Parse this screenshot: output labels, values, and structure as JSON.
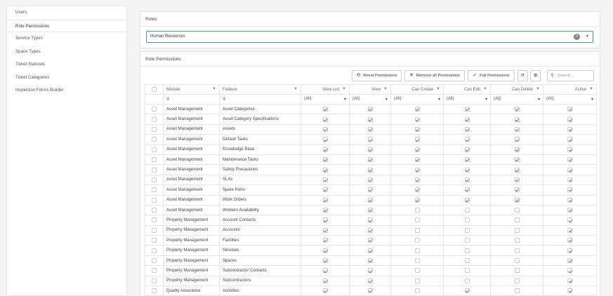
{
  "sidebar": {
    "items": [
      {
        "label": "Users",
        "active": false
      },
      {
        "label": "Role Permissions",
        "active": true
      },
      {
        "label": "Service Types",
        "active": false
      },
      {
        "label": "Space Types",
        "active": false
      },
      {
        "label": "Ticket Statuses",
        "active": false
      },
      {
        "label": "Ticket Categories",
        "active": false
      },
      {
        "label": "Inspection Forms Builder",
        "active": false
      }
    ]
  },
  "roles": {
    "title": "Roles",
    "selected": "Human Resources"
  },
  "permissions": {
    "title": "Role Permissions",
    "toolbar": {
      "reset_label": "Reset Permissions",
      "remove_label": "Remove all Permissions",
      "full_label": "Full Permissions",
      "search_placeholder": "Search..."
    },
    "columns": [
      "Module",
      "Feature",
      "View List",
      "View",
      "Can Create",
      "Can Edit",
      "Can Delete",
      "Active"
    ],
    "filter_all": "(All)",
    "rows": [
      {
        "module": "Asset Management",
        "feature": "Asset Categories",
        "view_list": true,
        "view": true,
        "can_create": true,
        "can_edit": true,
        "can_delete": true,
        "active": true
      },
      {
        "module": "Asset Management",
        "feature": "Asset Category Specifications",
        "view_list": true,
        "view": true,
        "can_create": true,
        "can_edit": true,
        "can_delete": true,
        "active": true
      },
      {
        "module": "Asset Management",
        "feature": "Assets",
        "view_list": true,
        "view": true,
        "can_create": true,
        "can_edit": true,
        "can_delete": true,
        "active": true
      },
      {
        "module": "Asset Management",
        "feature": "Default Tasks",
        "view_list": true,
        "view": true,
        "can_create": true,
        "can_edit": true,
        "can_delete": true,
        "active": true
      },
      {
        "module": "Asset Management",
        "feature": "Knowledge Base",
        "view_list": true,
        "view": true,
        "can_create": true,
        "can_edit": true,
        "can_delete": true,
        "active": true
      },
      {
        "module": "Asset Management",
        "feature": "Maintenance Tasks",
        "view_list": true,
        "view": true,
        "can_create": true,
        "can_edit": true,
        "can_delete": true,
        "active": true
      },
      {
        "module": "Asset Management",
        "feature": "Safety Precautions",
        "view_list": true,
        "view": true,
        "can_create": true,
        "can_edit": true,
        "can_delete": true,
        "active": true
      },
      {
        "module": "Asset Management",
        "feature": "SLAs",
        "view_list": true,
        "view": true,
        "can_create": true,
        "can_edit": true,
        "can_delete": true,
        "active": true
      },
      {
        "module": "Asset Management",
        "feature": "Spare Parts",
        "view_list": true,
        "view": true,
        "can_create": true,
        "can_edit": true,
        "can_delete": true,
        "active": true
      },
      {
        "module": "Asset Management",
        "feature": "Work Orders",
        "view_list": true,
        "view": true,
        "can_create": true,
        "can_edit": true,
        "can_delete": true,
        "active": true
      },
      {
        "module": "Asset Management",
        "feature": "Workers Availability",
        "view_list": true,
        "view": true,
        "can_create": false,
        "can_edit": false,
        "can_delete": false,
        "active": true
      },
      {
        "module": "Property Management",
        "feature": "Account Contacts",
        "view_list": true,
        "view": true,
        "can_create": false,
        "can_edit": false,
        "can_delete": false,
        "active": true
      },
      {
        "module": "Property Management",
        "feature": "Accounts",
        "view_list": true,
        "view": true,
        "can_create": false,
        "can_edit": false,
        "can_delete": false,
        "active": true
      },
      {
        "module": "Property Management",
        "feature": "Facilities",
        "view_list": true,
        "view": true,
        "can_create": false,
        "can_edit": false,
        "can_delete": false,
        "active": true
      },
      {
        "module": "Property Management",
        "feature": "Services",
        "view_list": true,
        "view": true,
        "can_create": false,
        "can_edit": false,
        "can_delete": false,
        "active": true
      },
      {
        "module": "Property Management",
        "feature": "Spaces",
        "view_list": true,
        "view": true,
        "can_create": false,
        "can_edit": false,
        "can_delete": false,
        "active": true
      },
      {
        "module": "Property Management",
        "feature": "Subcontractor Contacts",
        "view_list": true,
        "view": true,
        "can_create": false,
        "can_edit": false,
        "can_delete": false,
        "active": true
      },
      {
        "module": "Property Management",
        "feature": "Subcontractors",
        "view_list": true,
        "view": true,
        "can_create": false,
        "can_edit": false,
        "can_delete": false,
        "active": true
      },
      {
        "module": "Quality Assurance",
        "feature": "Activities",
        "view_list": true,
        "view": true,
        "can_create": false,
        "can_edit": true,
        "can_delete": false,
        "active": true
      }
    ]
  }
}
